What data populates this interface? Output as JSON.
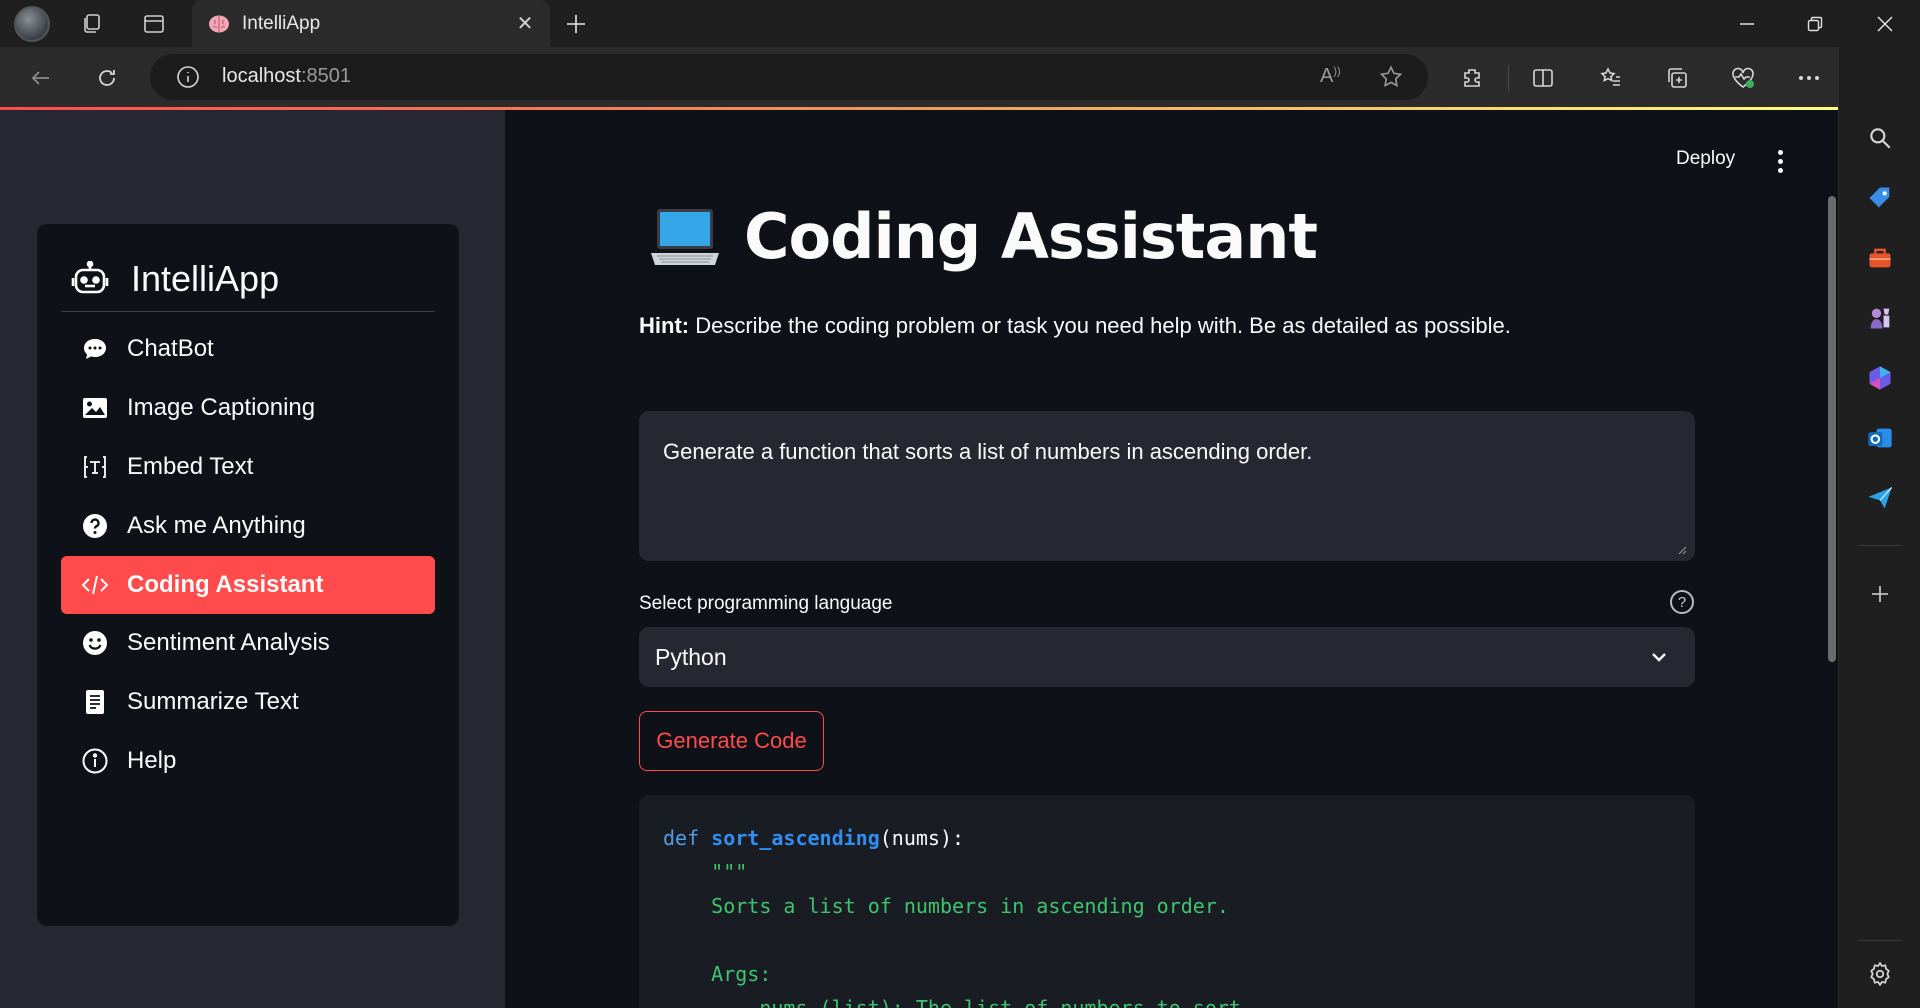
{
  "browser": {
    "tab_title": "IntelliApp",
    "url_host": "localhost",
    "url_port": ":8501"
  },
  "sidebar": {
    "brand": "IntelliApp",
    "items": [
      {
        "label": "ChatBot",
        "icon": "chat-bubble-icon"
      },
      {
        "label": "Image Captioning",
        "icon": "image-icon"
      },
      {
        "label": "Embed Text",
        "icon": "text-embed-icon"
      },
      {
        "label": "Ask me Anything",
        "icon": "question-icon"
      },
      {
        "label": "Coding Assistant",
        "icon": "code-icon",
        "active": true
      },
      {
        "label": "Sentiment Analysis",
        "icon": "smiley-icon"
      },
      {
        "label": "Summarize Text",
        "icon": "document-icon"
      },
      {
        "label": "Help",
        "icon": "info-icon"
      }
    ]
  },
  "header": {
    "deploy_label": "Deploy"
  },
  "main": {
    "title": "Coding Assistant",
    "hint_prefix": "Hint:",
    "hint_text": " Describe the coding problem or task you need help with. Be as detailed as possible.",
    "prompt_value": "Generate a function that sorts a list of numbers in ascending order.",
    "select_label": "Select programming language",
    "select_value": "Python",
    "generate_label": "Generate Code",
    "code": {
      "kw_def": "def",
      "func_name": "sort_ascending",
      "params": "(nums):",
      "docstring_open": "    \"\"\"",
      "doc_line1": "    Sorts a list of numbers in ascending order.",
      "doc_args": "    Args:",
      "doc_param": "        nums (list): The list of numbers to sort."
    }
  },
  "colors": {
    "accent": "#ff4b4b",
    "background": "#0e1117",
    "sidebar": "#262730"
  }
}
